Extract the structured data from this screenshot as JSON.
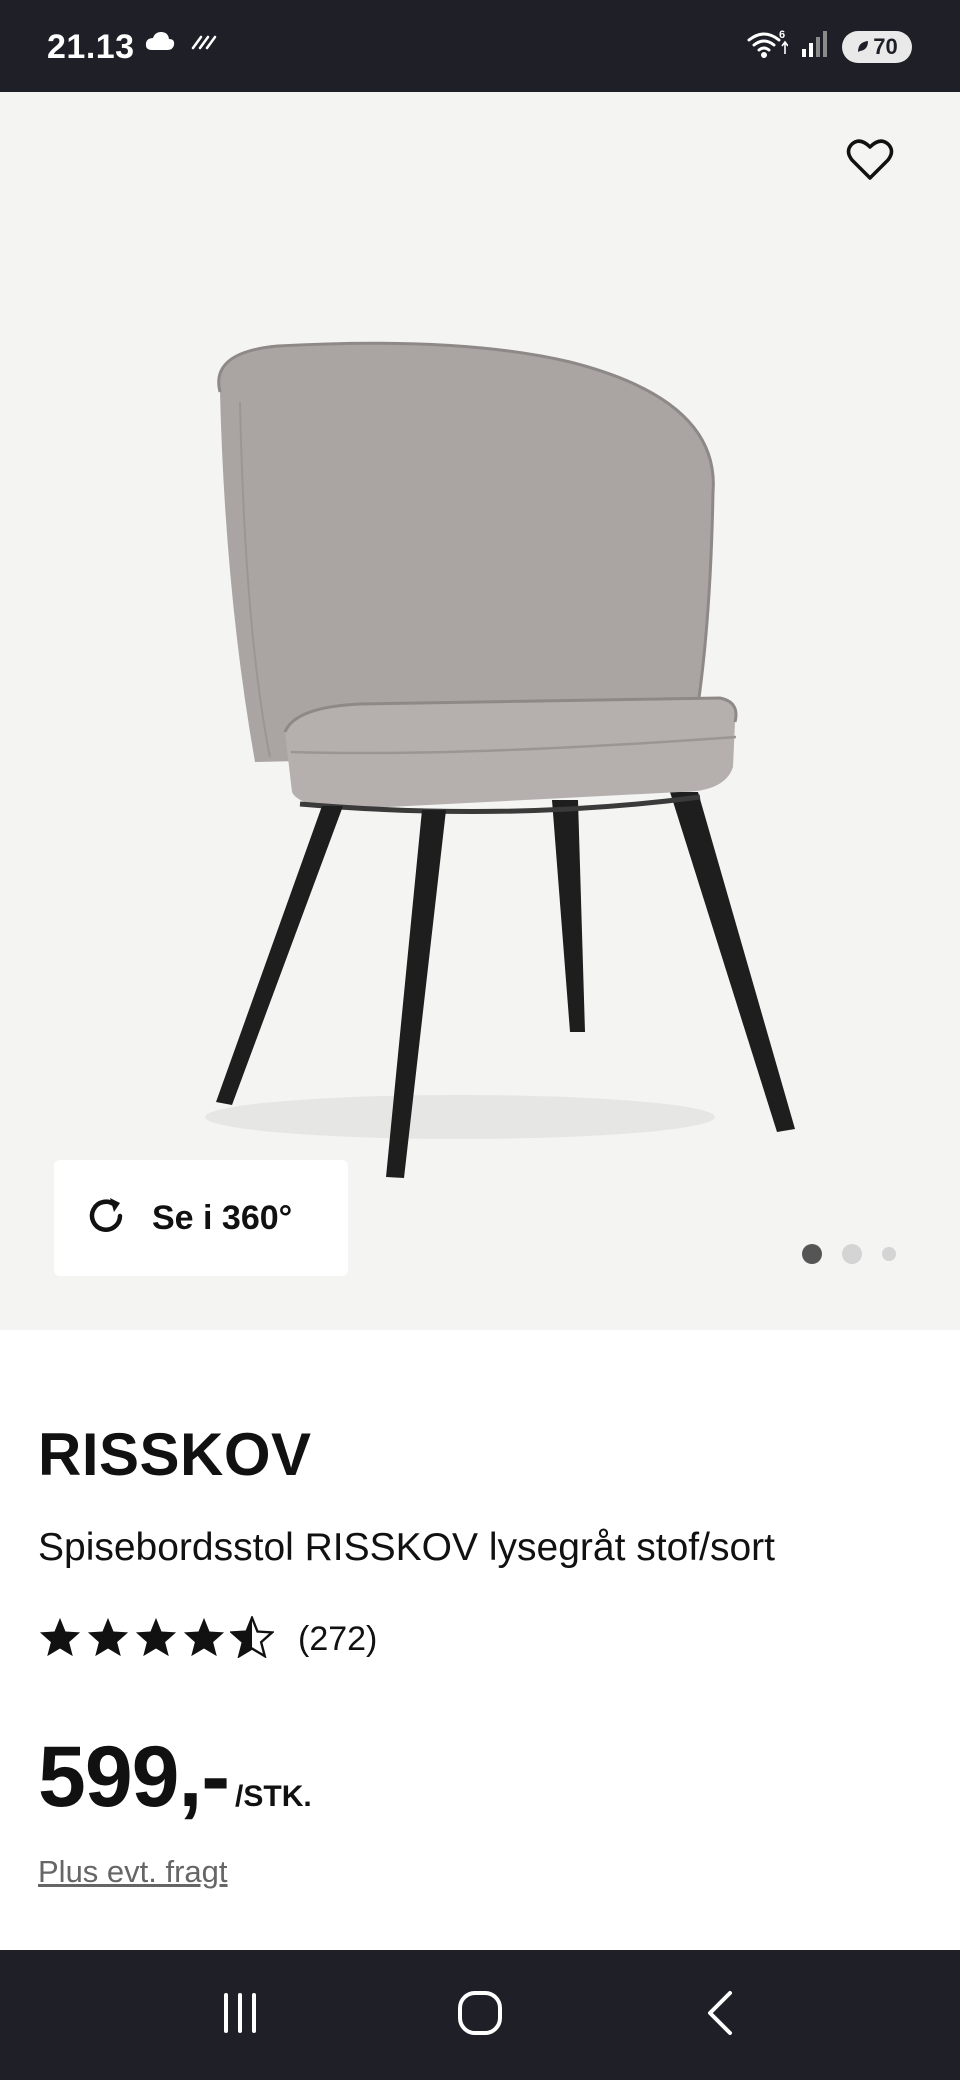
{
  "status_bar": {
    "time": "21.13",
    "battery": "70",
    "icons": [
      "cloud-icon",
      "data-stripes-icon",
      "wifi-icon",
      "signal-icon",
      "battery-icon"
    ]
  },
  "product_image": {
    "favorite_icon": "heart-outline-icon",
    "view_360_label": "Se i 360°",
    "view_360_icon": "rotate-icon",
    "carousel": {
      "count": 3,
      "active_index": 0
    }
  },
  "product": {
    "name": "RISSKOV",
    "description": "Spisebordsstol RISSKOV lysegråt stof/sort",
    "rating": {
      "value": 4.5,
      "max": 5,
      "count_label": "(272)"
    },
    "price": {
      "value": "599,-",
      "unit": "/STK."
    },
    "shipping_note": "Plus evt. fragt"
  },
  "nav_bar": {
    "buttons": [
      "recents-icon",
      "home-icon",
      "back-icon"
    ]
  },
  "colors": {
    "status_bar_bg": "#1f2027",
    "image_bg": "#f4f4f3",
    "chair_fabric": "#a9a4a2",
    "chair_legs": "#1e1e1e",
    "text_primary": "#111111",
    "text_secondary": "#666666"
  }
}
